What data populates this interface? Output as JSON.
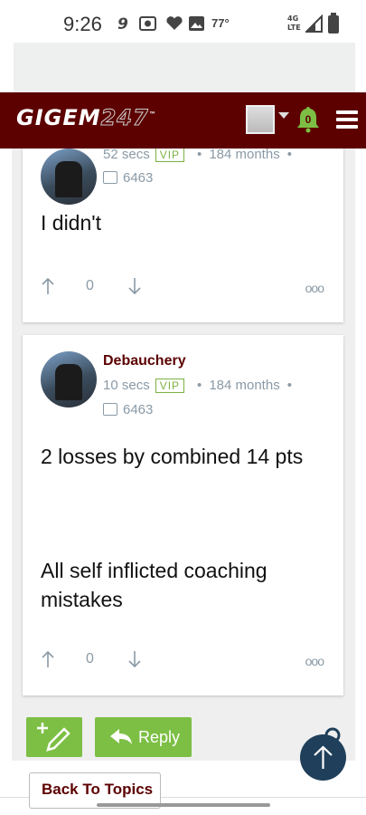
{
  "status_bar": {
    "time": "9:26",
    "temperature": "77°",
    "network": "4G LTE",
    "icons": [
      "notification-icon",
      "camera-icon",
      "heart-icon",
      "image-icon",
      "signal-icon",
      "battery-icon"
    ]
  },
  "header": {
    "logo_text_left": "GIGEM",
    "logo_text_right": "247",
    "logo_tm": "™",
    "notification_count": "0",
    "colors": {
      "header_bg": "#5c0000",
      "bell": "#7cbf44"
    }
  },
  "posts": [
    {
      "time_ago": "52 secs",
      "badge": "VIP",
      "tenure": "184 months",
      "comment_count": "6463",
      "body": "I didn't",
      "votes": "0"
    },
    {
      "username": "Debauchery",
      "time_ago": "10 secs",
      "badge": "VIP",
      "tenure": "184 months",
      "comment_count": "6463",
      "body_line1": "2 losses by combined 14 pts",
      "body_line2": "All self inflicted coaching mistakes",
      "votes": "0"
    }
  ],
  "actions": {
    "reply_label": "Reply",
    "back_label": "Back To Topics",
    "more_label": "ooo",
    "dot": "•"
  }
}
